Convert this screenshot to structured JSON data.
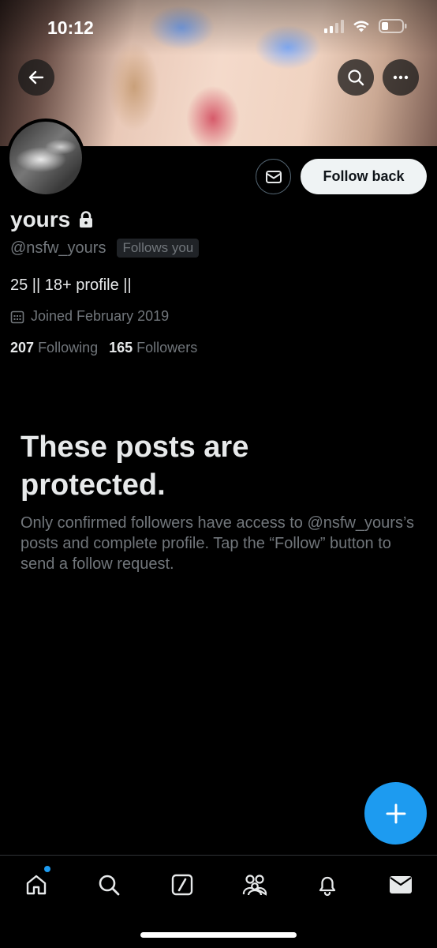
{
  "status_bar": {
    "time": "10:12"
  },
  "profile": {
    "display_name": "yours",
    "handle": "@nsfw_yours",
    "follows_you_badge": "Follows you",
    "bio": "25 || 18+ profile ||",
    "joined": "Joined February 2019",
    "following_count": "207",
    "following_label": "Following",
    "followers_count": "165",
    "followers_label": "Followers"
  },
  "actions": {
    "follow_button": "Follow back"
  },
  "protected_notice": {
    "title": "These posts are protected.",
    "body": "Only confirmed followers have access to @nsfw_yours’s posts and complete profile. Tap the “Follow” button to send a follow request."
  },
  "tabs": [
    {
      "icon": "home-icon",
      "has_badge": true
    },
    {
      "icon": "search-icon"
    },
    {
      "icon": "grok-icon"
    },
    {
      "icon": "communities-icon"
    },
    {
      "icon": "notifications-icon"
    },
    {
      "icon": "messages-icon"
    }
  ],
  "colors": {
    "accent": "#1d9bf0",
    "background": "#000000",
    "secondary_text": "#71767b",
    "primary_text": "#e7e9ea"
  }
}
